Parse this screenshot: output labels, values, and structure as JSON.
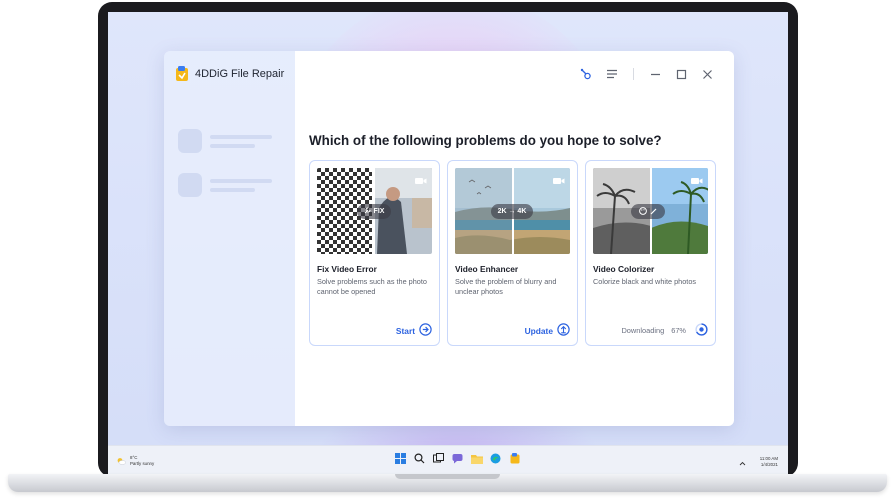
{
  "app": {
    "title": "4DDiG File Repair",
    "question": "Which of the following problems do you hope to solve?"
  },
  "window_controls": [
    "feedback-icon",
    "menu-icon",
    "minimize-icon",
    "maximize-icon",
    "close-icon"
  ],
  "cards": [
    {
      "title": "Fix Video Error",
      "description": "Solve problems such as the photo cannot be opened",
      "overlay": "FIX",
      "action_label": "Start",
      "action_icon": "arrow-right-circle-icon"
    },
    {
      "title": "Video Enhancer",
      "description": "Solve the problem of blurry and unclear photos",
      "overlay": "2K → 4K",
      "action_label": "Update",
      "action_icon": "upload-circle-icon"
    },
    {
      "title": "Video Colorizer",
      "description": "Colorize black and white photos",
      "action_label": "Downloading",
      "progress_text": "67%",
      "progress": 0.67,
      "action_icon": "progress-ring-icon"
    }
  ],
  "taskbar": {
    "weather_temp": "8°C",
    "weather_desc": "Partly sunny",
    "time": "11:00 AM",
    "date": "1/4/2021",
    "icons": [
      "windows-start-icon",
      "search-icon",
      "task-view-icon",
      "chat-icon",
      "file-explorer-icon",
      "edge-icon",
      "4ddig-app-icon"
    ]
  },
  "colors": {
    "accent": "#2d63e0",
    "card_border": "#c9d8fb",
    "wallpaper": "#d4ddf8"
  }
}
